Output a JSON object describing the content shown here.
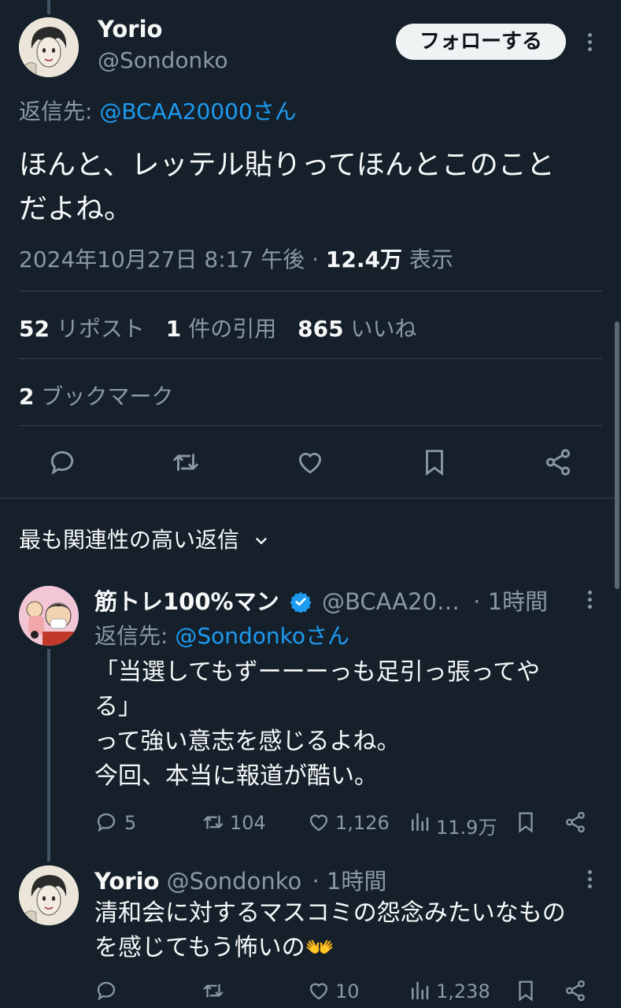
{
  "main_tweet": {
    "author_name": "Yorio",
    "author_handle": "@Sondonko",
    "follow_label": "フォローする",
    "reply_prefix": "返信先:",
    "reply_to": "@BCAA20000さん",
    "text_line1": "ほんと、レッテル貼りってほんとこのこと",
    "text_line2": "だよね。",
    "timestamp": "2024年10月27日 8:17 午後",
    "separator": "·",
    "views_count": "12.4万",
    "views_label": "表示",
    "reposts_count": "52",
    "reposts_label": "リポスト",
    "quotes_count": "1",
    "quotes_label": "件の引用",
    "likes_count": "865",
    "likes_label": "いいね",
    "bookmarks_count": "2",
    "bookmarks_label": "ブックマーク"
  },
  "sort": {
    "label": "最も関連性の高い返信"
  },
  "replies": [
    {
      "author_name": "筋トレ100%マン",
      "author_handle": "@BCAA20…",
      "time": "· 1時間",
      "reply_prefix": "返信先:",
      "reply_to": "@Sondonkoさん",
      "lines": [
        "「当選してもずーーーっも足引っ張ってや",
        "る」",
        "って強い意志を感じるよね。",
        "今回、本当に報道が酷い。"
      ],
      "replies_count": "5",
      "reposts_count": "104",
      "likes_count": "1,126",
      "views_count": "11.9万"
    },
    {
      "author_name": "Yorio",
      "author_handle": "@Sondonko",
      "time": "· 1時間",
      "lines": [
        "清和会に対するマスコミの怨念みたいなもの",
        "を感じてもう怖いの"
      ],
      "emoji": "👐",
      "likes_count": "10",
      "views_count": "1,238"
    }
  ],
  "colors": {
    "background": "#15202b",
    "text": "#f7f9f9",
    "muted": "#8b98a5",
    "link": "#1d9bf0",
    "verified": "#1d9bf0",
    "divider": "#38444d"
  },
  "icons": [
    "reply-icon",
    "repost-icon",
    "like-icon",
    "bookmark-icon",
    "share-icon",
    "views-icon",
    "verified-badge-icon",
    "chevron-down-icon",
    "more-icon"
  ]
}
